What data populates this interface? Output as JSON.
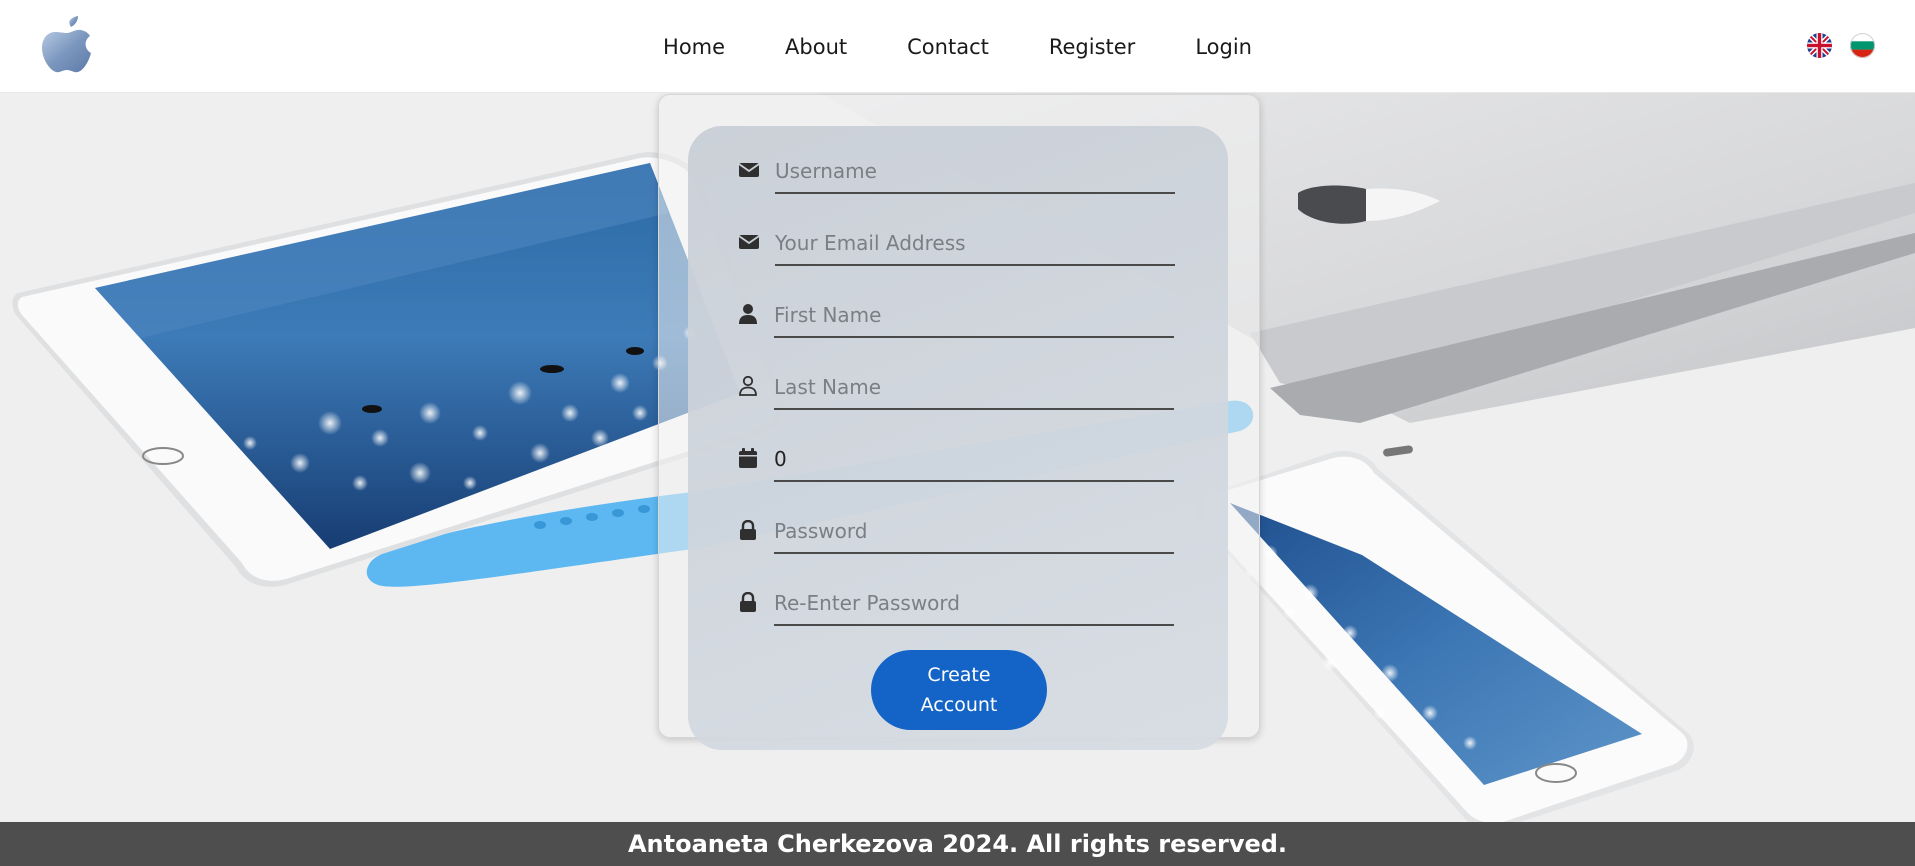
{
  "header": {
    "logo_icon": "apple-logo-icon",
    "nav": [
      {
        "label": "Home"
      },
      {
        "label": "About"
      },
      {
        "label": "Contact"
      },
      {
        "label": "Register"
      },
      {
        "label": "Login"
      }
    ],
    "languages": [
      {
        "icon": "uk-flag-icon"
      },
      {
        "icon": "bulgaria-flag-icon"
      }
    ]
  },
  "form": {
    "username": {
      "placeholder": "Username",
      "value": "",
      "icon": "envelope-icon"
    },
    "email": {
      "placeholder": "Your Email Address",
      "value": "",
      "icon": "envelope-icon"
    },
    "first_name": {
      "placeholder": "First Name",
      "value": "",
      "icon": "user-solid-icon"
    },
    "last_name": {
      "placeholder": "Last Name",
      "value": "",
      "icon": "user-outline-icon"
    },
    "age": {
      "placeholder": "",
      "value": "0",
      "icon": "calendar-icon"
    },
    "password": {
      "placeholder": "Password",
      "value": "",
      "icon": "lock-icon"
    },
    "confirm_password": {
      "placeholder": "Re-Enter Password",
      "value": "",
      "icon": "lock-icon"
    },
    "submit_label": "Create Account"
  },
  "footer": {
    "text": "Antoaneta Cherkezova 2024. All rights reserved."
  },
  "colors": {
    "accent": "#1464c8",
    "footer_bg": "#4e4e4e",
    "header_bg": "#ffffff"
  }
}
